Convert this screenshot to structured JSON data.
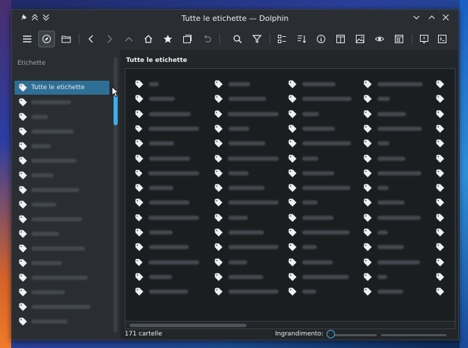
{
  "window": {
    "title": "Tutte le etichette — Dolphin"
  },
  "titlebar_icons": [
    "pin-icon",
    "keep-above-icon",
    "keep-below-icon"
  ],
  "toolbar": {
    "buttons": [
      "menu-icon",
      "navigator-icon",
      "folder-icon",
      "back-icon",
      "forward-icon",
      "up-icon",
      "home-icon",
      "favorite-icon",
      "new-tab-icon",
      "undo-icon",
      "search-icon",
      "filter-icon",
      "view-mode-icon",
      "sort-icon",
      "information-icon",
      "split-view-icon",
      "preview-icon",
      "hidden-files-icon",
      "tab-icon",
      "terminal-panel-icon",
      "terminal-icon"
    ]
  },
  "sidebar": {
    "header": "Etichette",
    "items": [
      {
        "label": "Tutte le etichette"
      }
    ]
  },
  "content": {
    "location": "Tutte le etichette",
    "status_count": "171 cartelle",
    "zoom_label": "Ingrandimento:"
  },
  "colors": {
    "accent": "#3daee9",
    "selection": "#2f6f96",
    "window_bg": "#232629"
  }
}
